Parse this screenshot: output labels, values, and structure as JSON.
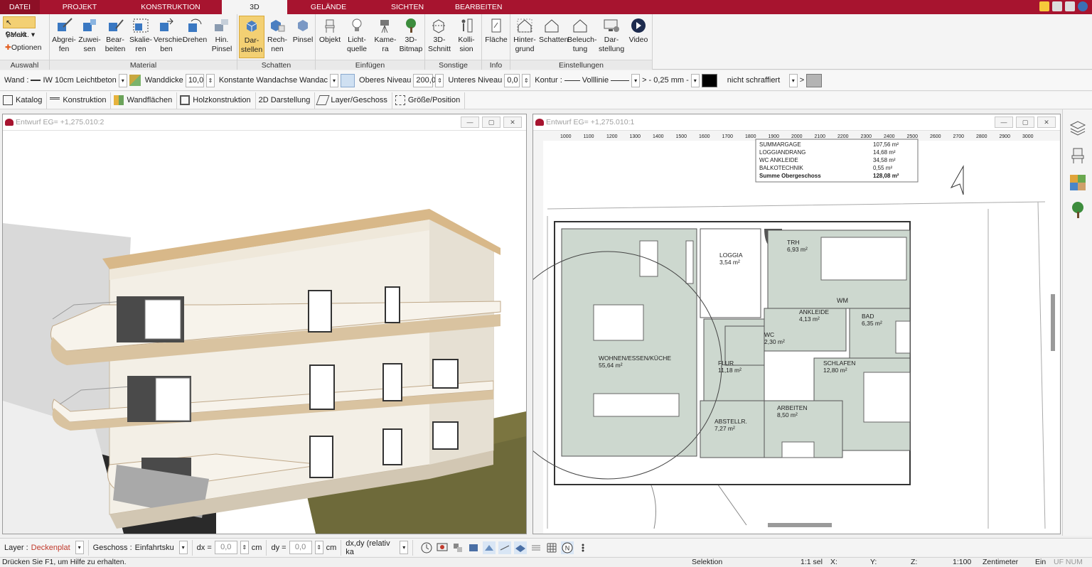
{
  "tabs": [
    {
      "label": "DATEI",
      "active": false
    },
    {
      "label": "PROJEKT",
      "active": false
    },
    {
      "label": "KONSTRUKTION",
      "active": false
    },
    {
      "label": "3D",
      "active": true
    },
    {
      "label": "GELÄNDE",
      "active": false
    },
    {
      "label": "SICHTEN",
      "active": false
    },
    {
      "label": "BEARBEITEN",
      "active": false
    }
  ],
  "ribbon": {
    "auswahl": {
      "label": "Auswahl",
      "selekt": "Selekt",
      "mark": "Mark.",
      "optionen": "Optionen"
    },
    "material": {
      "label": "Material",
      "buttons": [
        "Abgrei-\nfen",
        "Zuwei-\nsen",
        "Bear-\nbeiten",
        "Skalie-\nren",
        "Verschie-\nben",
        "Drehen",
        "Hin.\nPinsel"
      ]
    },
    "schatten": {
      "label": "Schatten",
      "buttons": [
        "Dar-\nstellen",
        "Rech-\nnen",
        "Pinsel"
      ]
    },
    "einfuegen": {
      "label": "Einfügen",
      "buttons": [
        "Objekt",
        "Licht-\nquelle",
        "Kame-\nra",
        "3D-\nBitmap"
      ]
    },
    "sonstige": {
      "label": "Sonstige",
      "buttons": [
        "3D-\nSchnitt",
        "Kolli-\nsion"
      ]
    },
    "info": {
      "label": "Info",
      "buttons": [
        "Fläche"
      ]
    },
    "einstellungen": {
      "label": "Einstellungen",
      "buttons": [
        "Hinter-\ngrund",
        "Schatten",
        "Beleuch-\ntung",
        "Dar-\nstellung",
        "Video"
      ]
    }
  },
  "propbar": {
    "wand_label": "Wand :",
    "wand_value": "IW 10cm Leichtbeton",
    "wanddicke_label": "Wanddicke",
    "wanddicke_value": "10,0",
    "wandachse_label": "Konstante Wandachse",
    "wandachse_value": "Wandac",
    "oberes_label": "Oberes Niveau",
    "oberes_value": "200,0",
    "unteres_label": "Unteres Niveau",
    "unteres_value": "0,0",
    "kontur_label": "Kontur :",
    "linie_value": "Volllinie",
    "gt1": ">",
    "stroke_value": "- 0,25 mm -",
    "schraffur_value": "nicht schraffiert",
    "gt2": ">"
  },
  "toolbar2": [
    "Katalog",
    "Konstruktion",
    "Wandflächen",
    "Holzkonstruktion",
    "2D Darstellung",
    "Layer/Geschoss",
    "Größe/Position"
  ],
  "view3d": {
    "title": "Entwurf EG= +1,275.010:2"
  },
  "view2d": {
    "title": "Entwurf EG= +1,275.010:1",
    "ruler": [
      "1000",
      "1100",
      "1200",
      "1300",
      "1400",
      "1500",
      "1600",
      "1700",
      "1800",
      "1900",
      "2000",
      "2100",
      "2200",
      "2300",
      "2400",
      "2500",
      "2600",
      "2700",
      "2800",
      "2900",
      "3000"
    ],
    "legend_rows": [
      {
        "name": "SUMMARGAGE",
        "value": "107,56 m²"
      },
      {
        "name": "LOGGIANDRANG",
        "value": "14,68 m²"
      },
      {
        "name": "WC ANKLEIDE",
        "value": "34,58 m²"
      },
      {
        "name": "BALKOTECHNIK",
        "value": "0,55 m²"
      },
      {
        "name": "Summe Obergeschoss",
        "value": "128,08 m²"
      }
    ],
    "rooms": [
      {
        "name": "TRH",
        "area": "6,93 m²"
      },
      {
        "name": "LOGGIA",
        "area": "3,54 m²"
      },
      {
        "name": "ANKLEIDE",
        "area": "4,13 m²"
      },
      {
        "name": "BAD",
        "area": "6,35 m²"
      },
      {
        "name": "WC",
        "area": "2,30 m²"
      },
      {
        "name": "WOHNEN/ESSEN/KÜCHE",
        "area": "55,64 m²"
      },
      {
        "name": "FLUR",
        "area": "11,18 m²"
      },
      {
        "name": "SCHLAFEN",
        "area": "12,80 m²"
      },
      {
        "name": "ABSTELLR.",
        "area": "7,27 m²"
      },
      {
        "name": "ARBEITEN",
        "area": "8,50 m²"
      }
    ],
    "wm": "WM"
  },
  "bottombar": {
    "layer_label": "Layer :",
    "layer_value": "Deckenplat",
    "geschoss_label": "Geschoss :",
    "geschoss_value": "Einfahrtsku",
    "dx_label": "dx =",
    "dx_value": "0,0",
    "dx_unit": "cm",
    "dy_label": "dy =",
    "dy_value": "0,0",
    "dy_unit": "cm",
    "mode_value": "dx,dy (relativ ka"
  },
  "status": {
    "hint": "Drücken Sie F1, um Hilfe zu erhalten.",
    "selektion": "Selektion",
    "sel": "1:1 sel",
    "x": "X:",
    "y": "Y:",
    "z": "Z:",
    "scale": "1:100",
    "unit": "Zentimeter",
    "ein": "Ein",
    "flags": "UF NUM RF"
  },
  "colors": {
    "brand": "#a7142f",
    "active": "#f3d073",
    "plan_fill": "#cdd8cf"
  }
}
